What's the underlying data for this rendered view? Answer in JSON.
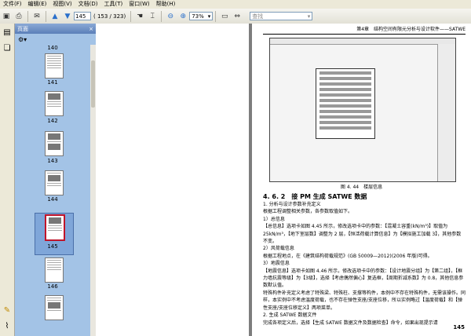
{
  "menu": [
    "文件(F)",
    "编辑(E)",
    "视图(V)",
    "文档(D)",
    "工具(T)",
    "窗口(W)",
    "帮助(H)"
  ],
  "toolbar": {
    "current_page": "145",
    "page_count": "( 153 / 323)",
    "zoom": "73%",
    "search_placeholder": "查找"
  },
  "panel": {
    "title": "页面",
    "close": "×"
  },
  "thumbnails": [
    {
      "label": "140",
      "selected": false
    },
    {
      "label": "141",
      "selected": false
    },
    {
      "label": "142",
      "selected": false
    },
    {
      "label": "143",
      "selected": false
    },
    {
      "label": "144",
      "selected": false
    },
    {
      "label": "145",
      "selected": true
    },
    {
      "label": "146",
      "selected": false
    }
  ],
  "page": {
    "header": "第4章　结构空间有限元分析与设计软件——SATWE",
    "caption": "图 4. 44　楼层信息",
    "section": "4. 6. 2　接 PM 生成 SATWE 数据",
    "paragraphs": [
      "1. 分析与设计参数补充定义",
      "根据工程调整相关参数，各参数取值如下。",
      "1）总信息",
      "【总信息】选项卡如图 4.45 所示，修改选项卡中的参数：【混凝土容重(kN/m³)】取值为 25kN/m³，【地下室层数】调整为 2 层，【恒活荷载计算信息】为【模拟施工加载 3】，其他参数不变。",
      "2）风荷载信息",
      "根据工程地点，在《建筑结构荷载规范》(GB 50009—2012)(2006 年版)可得。",
      "3）地震信息",
      "【地震信息】选项卡如图 4.46 所示，修改选项卡中的参数：【设计地震分组】为【第二组】，【框力墙抗震等级】为【3级】，选择【考虑偶然偏心】复选框，【周期折减系数】为 0.8，其他信息参数默认值。",
      "特殊构件补充定义考虑了特殊梁、特殊柱、支撑等构件，本例中不存在特殊构件，无需该操作。同样，本实例中不考虑温度荷载，也不存在弹性支座/支座位移，所以实例略过【温度荷载】和【弹性支座/支座位移定义】两项菜单。",
      "2. 生成 SATWE 数据文件",
      "完成各项定义后，选择【生成 SATWE 数据文件及数据检查】命令，如果出现提示请"
    ],
    "page_number": "145"
  }
}
